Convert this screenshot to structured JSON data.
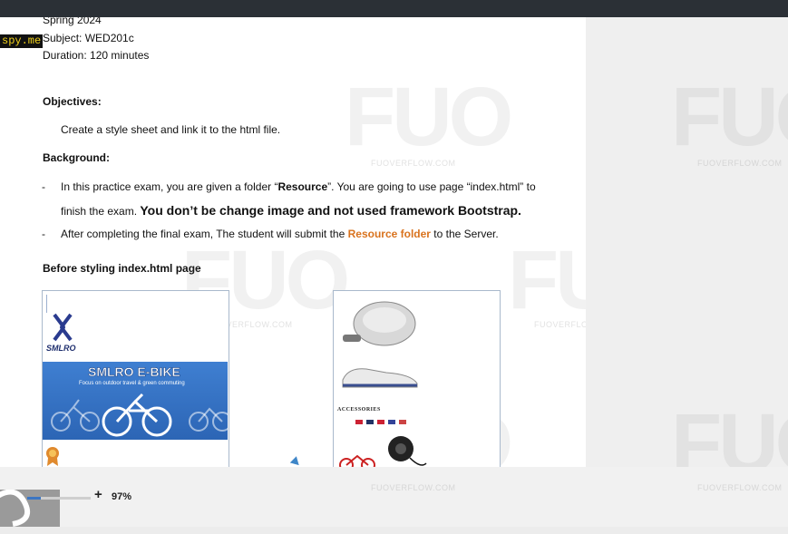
{
  "overlay": {
    "spy_tag": "spy.me"
  },
  "doc": {
    "semester": "Spring 2024",
    "subject": "Subject: WED201c",
    "duration": "Duration: 120 minutes",
    "objectives_heading": "Objectives:",
    "objectives_text": "Create a style sheet and link it to the html file.",
    "background_heading": "Background:",
    "bullet_marker": "-",
    "bullet1_line1_a": "In this practice exam, you are given a folder “",
    "bullet1_line1_b": "Resource",
    "bullet1_line1_c": "”. You are going to use page “index.html”  to",
    "bullet1_line2_a": "finish the exam. ",
    "bullet1_line2_b": "You don’t be change image and not used framework Bootstrap.",
    "bullet2_a": "After completing the final exam, The student will submit the ",
    "bullet2_b": "Resource folder",
    "bullet2_c": " to the Server.",
    "before_heading": "Before styling index.html page"
  },
  "left_preview": {
    "brand": "SMLRO",
    "banner_title": "SMLRO E-BIKE",
    "banner_sub": "Focus on outdoor travel & green commuting"
  },
  "right_preview": {
    "accessories_label": "ACCESSORIES"
  },
  "watermark": {
    "logo": "FUO",
    "domain": "FUOVERFLOW.COM"
  },
  "statusbar": {
    "zoom_plus": "+",
    "zoom_value": "97%",
    "zoom_fraction": 0.97
  },
  "colors": {
    "highlight_orange": "#d9731e",
    "banner_blue": "#2c65b5",
    "topbar": "#2b3036"
  }
}
